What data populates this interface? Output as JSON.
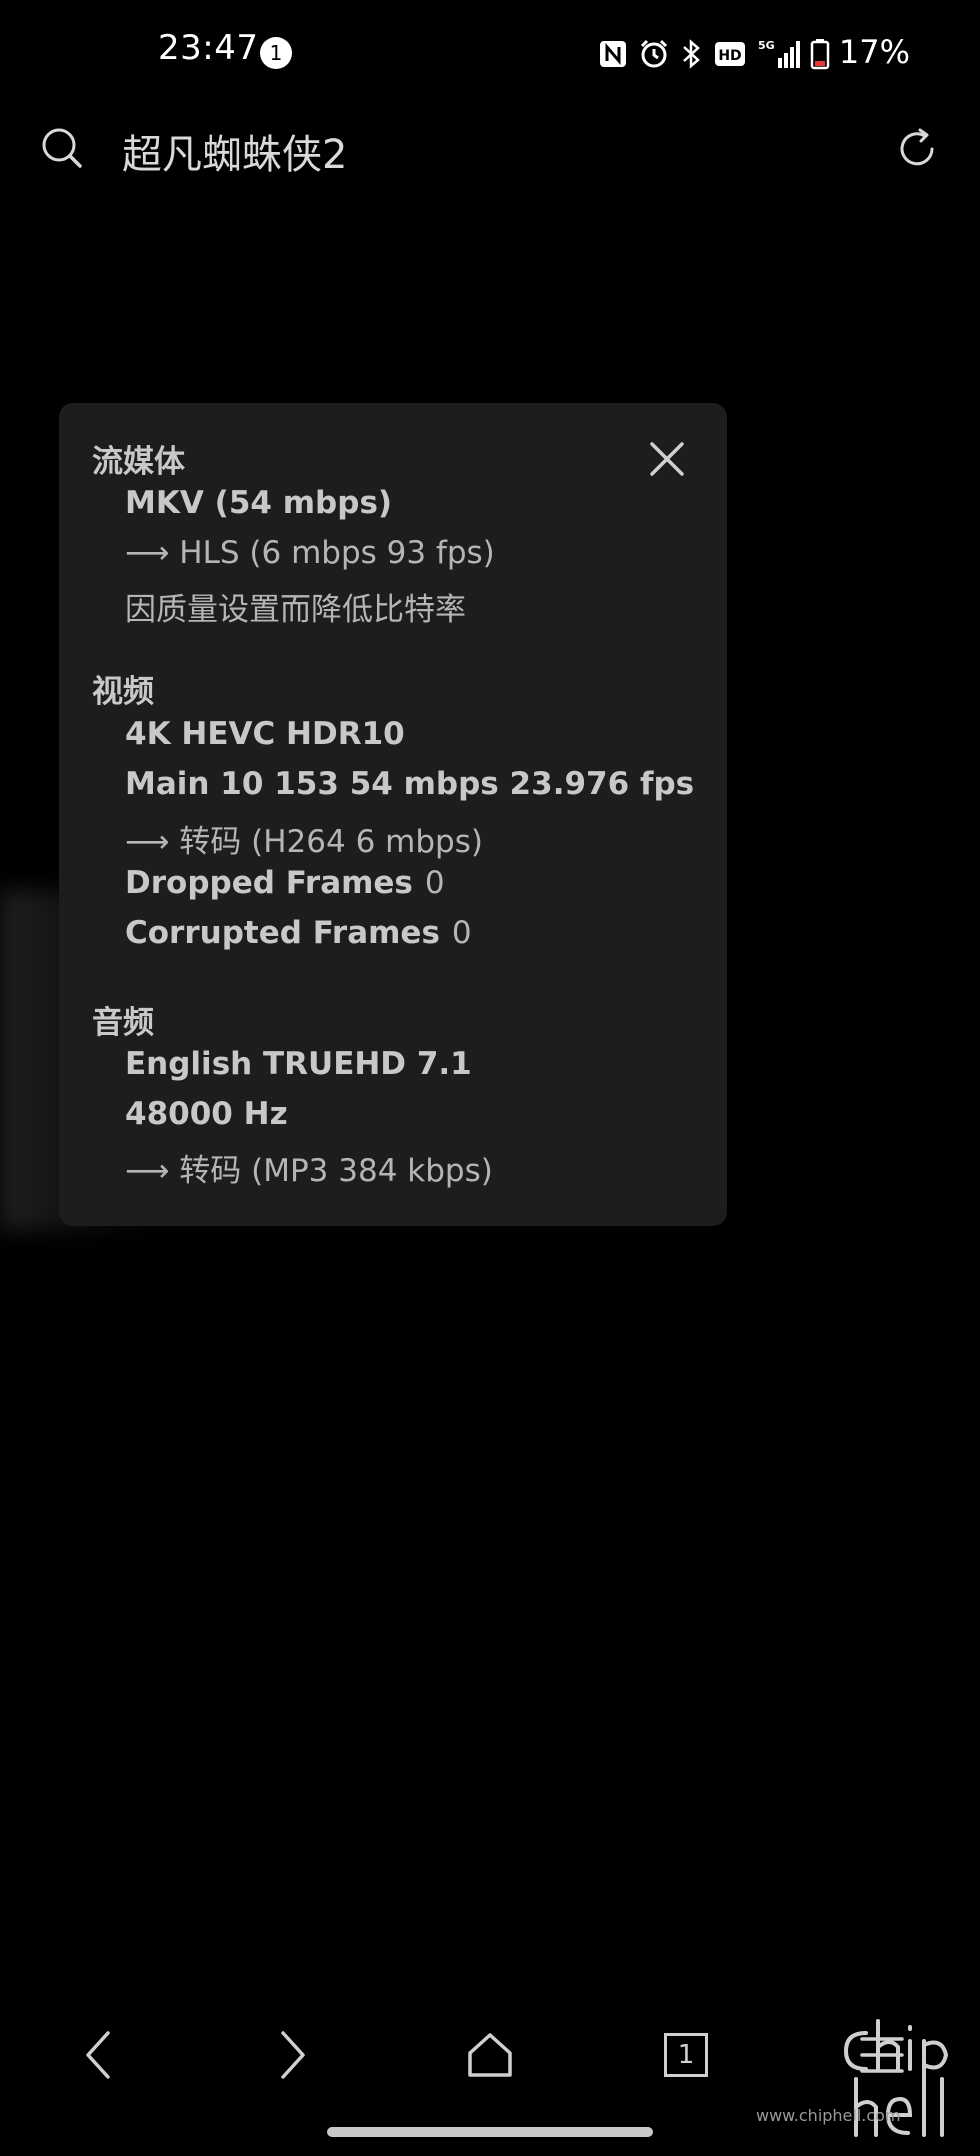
{
  "status_bar": {
    "time": "23:47",
    "notification_count": "1",
    "battery_percent": "17%",
    "icons": [
      "nfc-icon",
      "alarm-icon",
      "bluetooth-icon",
      "hd-icon",
      "5g-signal-icon",
      "battery-icon"
    ],
    "hd_label": "HD",
    "network_label": "5G"
  },
  "top_bar": {
    "title": "超凡蜘蛛侠2",
    "left_icon": "search-icon",
    "right_icon": "refresh-icon"
  },
  "info_panel": {
    "close_icon": "close-icon",
    "streaming": {
      "title": "流媒体",
      "container": "MKV (54 mbps)",
      "transcode": "⟶ HLS (6 mbps 93 fps)",
      "note": "因质量设置而降低比特率"
    },
    "video": {
      "title": "视频",
      "format": "4K HEVC HDR10",
      "profile": "Main 10 153 54 mbps 23.976 fps",
      "transcode": "⟶ 转码 (H264 6 mbps)",
      "dropped_label": "Dropped Frames",
      "dropped_value": "0",
      "corrupted_label": "Corrupted Frames",
      "corrupted_value": "0"
    },
    "audio": {
      "title": "音频",
      "track": "English TRUEHD 7.1",
      "sample_rate": "48000 Hz",
      "transcode": "⟶ 转码 (MP3 384 kbps)"
    }
  },
  "bottom_nav": {
    "back_icon": "chevron-left-icon",
    "forward_icon": "chevron-right-icon",
    "home_icon": "home-icon",
    "tab_count": "1",
    "menu_icon": "menu-icon"
  },
  "watermark": {
    "url": "www.chiphell.com"
  },
  "colors": {
    "background": "#000000",
    "panel": "#1e1e1e",
    "text": "#c8c8c8"
  }
}
